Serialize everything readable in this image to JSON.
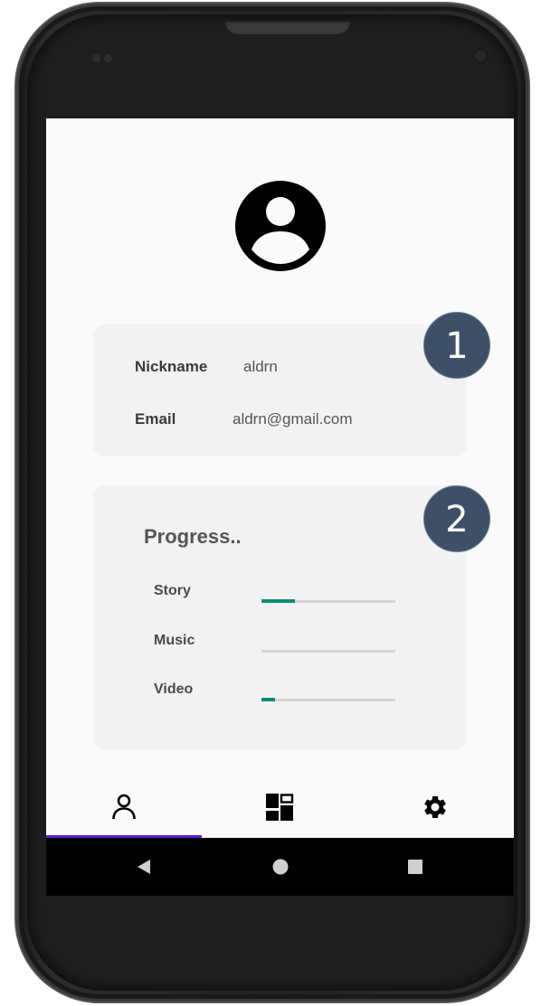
{
  "profile": {
    "nickname_label": "Nickname",
    "nickname_value": "aldrn",
    "email_label": "Email",
    "email_value": "aldrn@gmail.com"
  },
  "progress": {
    "title": "Progress..",
    "items": [
      {
        "label": "Story",
        "value": 0.25
      },
      {
        "label": "Music",
        "value": 0
      },
      {
        "label": "Video",
        "value": 0.1
      }
    ]
  },
  "bottom_nav": {
    "items": [
      {
        "icon": "person-outline-icon",
        "selected": true
      },
      {
        "icon": "dashboard-icon",
        "selected": false
      },
      {
        "icon": "settings-gear-icon",
        "selected": false
      }
    ]
  },
  "system_nav": {
    "items": [
      "back-icon",
      "home-icon",
      "recents-icon"
    ]
  },
  "callouts": {
    "first": "1",
    "second": "2"
  },
  "colors": {
    "progress_fill": "#128a78",
    "nav_indicator": "#5b1fd3",
    "badge": "#3e5068",
    "card_bg": "#f2f2f2"
  }
}
